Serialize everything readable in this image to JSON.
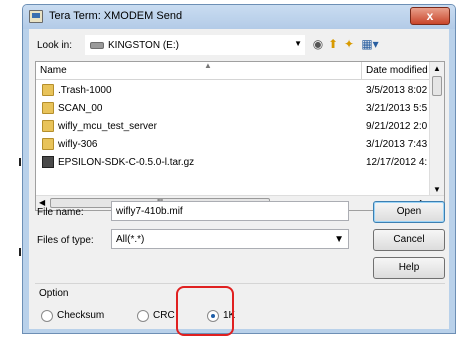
{
  "window": {
    "title": "Tera Term: XMODEM Send",
    "close_label": "x"
  },
  "lookin": {
    "label": "Look in:",
    "value": "KINGSTON (E:)"
  },
  "toolbar_icons": [
    "back-icon",
    "up-folder-icon",
    "new-folder-icon",
    "view-menu-icon"
  ],
  "filelist": {
    "columns": {
      "name": "Name",
      "date": "Date modified"
    },
    "rows": [
      {
        "name": ".Trash-1000",
        "date": "3/5/2013 8:02",
        "icon": "folder-icon"
      },
      {
        "name": "SCAN_00",
        "date": "3/21/2013 5:5",
        "icon": "folder-icon"
      },
      {
        "name": "wifly_mcu_test_server",
        "date": "9/21/2012 2:0",
        "icon": "folder-icon"
      },
      {
        "name": "wifly-306",
        "date": "3/1/2013 7:43",
        "icon": "folder-icon"
      },
      {
        "name": "EPSILON-SDK-C-0.5.0-l.tar.gz",
        "date": "12/17/2012 4:",
        "icon": "archive-icon"
      }
    ],
    "hscroll_thumb": "III"
  },
  "filename": {
    "label": "File name:",
    "value": "wifly7-410b.mif"
  },
  "filetype": {
    "label": "Files of type:",
    "value": "All(*.*)"
  },
  "buttons": {
    "open": "Open",
    "cancel": "Cancel",
    "help": "Help"
  },
  "option": {
    "label": "Option",
    "choices": [
      "Checksum",
      "CRC",
      "1K"
    ],
    "selected": "1K"
  },
  "colors": {
    "highlight": "#e02020",
    "titlebar": "#b9d1ea"
  }
}
